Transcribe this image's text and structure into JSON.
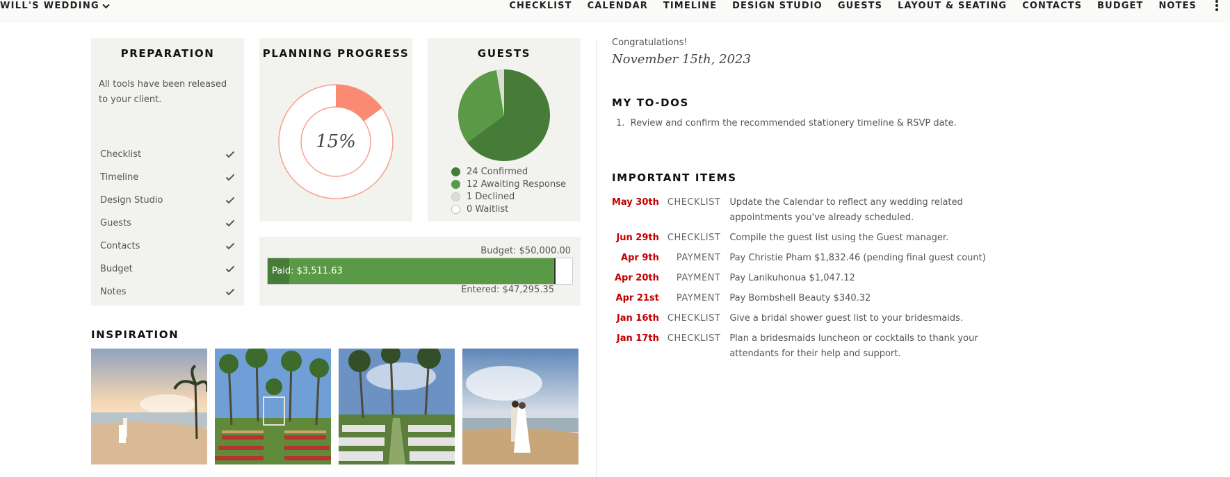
{
  "brand": {
    "title": "WILL'S WEDDING"
  },
  "nav": [
    "CHECKLIST",
    "CALENDAR",
    "TIMELINE",
    "DESIGN STUDIO",
    "GUESTS",
    "LAYOUT & SEATING",
    "CONTACTS",
    "BUDGET",
    "NOTES"
  ],
  "preparation": {
    "title": "PREPARATION",
    "note": "All tools have been released to your client.",
    "items": [
      "Checklist",
      "Timeline",
      "Design Studio",
      "Guests",
      "Contacts",
      "Budget",
      "Notes"
    ]
  },
  "progress": {
    "title": "PLANNING PROGRESS",
    "percent_label": "15%",
    "value": 0.15
  },
  "guests": {
    "title": "GUESTS",
    "legend": [
      {
        "label": "24 Confirmed",
        "count": 24,
        "color": "#467c37"
      },
      {
        "label": "12 Awaiting Response",
        "count": 12,
        "color": "#5a9a46"
      },
      {
        "label": "1 Declined",
        "count": 1,
        "color": "#dcdcd6"
      },
      {
        "label": "0 Waitlist",
        "count": 0,
        "color": "#ffffff"
      }
    ]
  },
  "budget": {
    "total_label": "Budget: $50,000.00",
    "paid_label": "Paid: $3,511.63",
    "entered_label": "Entered: $47,295.35",
    "total": 50000.0,
    "paid": 3511.63,
    "entered": 47295.35
  },
  "inspiration": {
    "title": "INSPIRATION"
  },
  "right": {
    "congrats": "Congratulations!",
    "date": "November 15th, 2023",
    "todos_title": "MY TO-DOS",
    "todos": [
      "Review and confirm the recommended stationery timeline & RSVP date."
    ],
    "important_title": "IMPORTANT ITEMS",
    "important": [
      {
        "date": "May 30th",
        "cat": "CHECKLIST",
        "text": "Update the Calendar to reflect any wedding related appointments you've already scheduled."
      },
      {
        "date": "Jun 29th",
        "cat": "CHECKLIST",
        "text": "Compile the guest list using the Guest manager."
      },
      {
        "date": "Apr 9th",
        "cat": "PAYMENT",
        "text": "Pay Christie Pham $1,832.46 (pending final guest count)"
      },
      {
        "date": "Apr 20th",
        "cat": "PAYMENT",
        "text": "Pay Lanikuhonua $1,047.12"
      },
      {
        "date": "Apr 21st",
        "cat": "PAYMENT",
        "text": "Pay Bombshell Beauty $340.32"
      },
      {
        "date": "Jan 16th",
        "cat": "CHECKLIST",
        "text": "Give a bridal shower guest list to your bridesmaids."
      },
      {
        "date": "Jan 17th",
        "cat": "CHECKLIST",
        "text": "Plan a bridesmaids luncheon or cocktails to thank your attendants for their help and support."
      }
    ]
  },
  "colors": {
    "accent_red": "#c00000",
    "progress": "#fa8a72",
    "panel": "#f2f2ee"
  }
}
